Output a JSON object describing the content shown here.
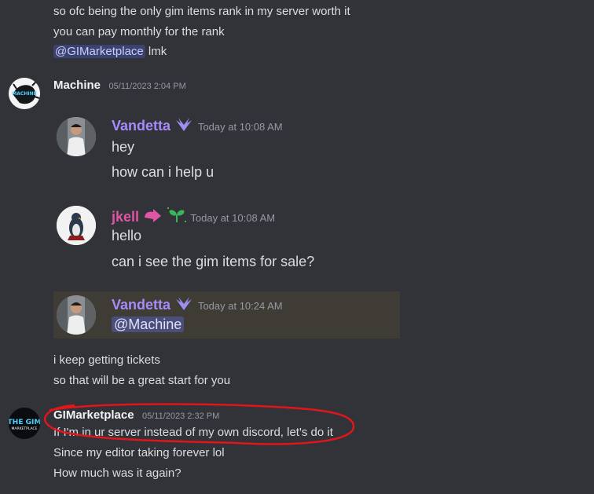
{
  "top_messages": [
    "so ofc being the only gim items rank in my server worth it",
    "you can pay monthly for the rank"
  ],
  "top_mention": "@GIMarketplace",
  "top_mention_tail": " lmk",
  "machine_msg": {
    "author": "Machine",
    "timestamp": "05/11/2023 2:04 PM",
    "avatar_text": "THE GIM MACHINE"
  },
  "embed": {
    "msg1": {
      "author": "Vandetta",
      "author_color": "#a78bfa",
      "timestamp": "Today at 10:08 AM",
      "lines": [
        "hey",
        "how can i help u"
      ]
    },
    "msg2": {
      "author": "jkell",
      "author_color": "#e056a7",
      "timestamp": "Today at 10:08 AM",
      "lines": [
        "hello",
        "can i see the gim items for sale?"
      ]
    },
    "msg3": {
      "author": "Vandetta",
      "author_color": "#a78bfa",
      "timestamp": "Today at 10:24 AM",
      "mention": "@Machine"
    }
  },
  "machine_followups": [
    "i keep getting tickets",
    "so that will be a great start for you"
  ],
  "gim_msg": {
    "author": "GIMarketplace",
    "timestamp": "05/11/2023 2:32 PM",
    "avatar_text": "THE GIM MARKETPLACE",
    "lines": [
      "If I'm in ur server instead of my own discord, let's do it",
      "Since my editor taking forever lol",
      "How much was it again?"
    ]
  },
  "colors": {
    "background": "#313338",
    "annotation_red": "#e0161b",
    "highlight_bg": "#3f3c35",
    "mention_bg": "#3c4270"
  }
}
